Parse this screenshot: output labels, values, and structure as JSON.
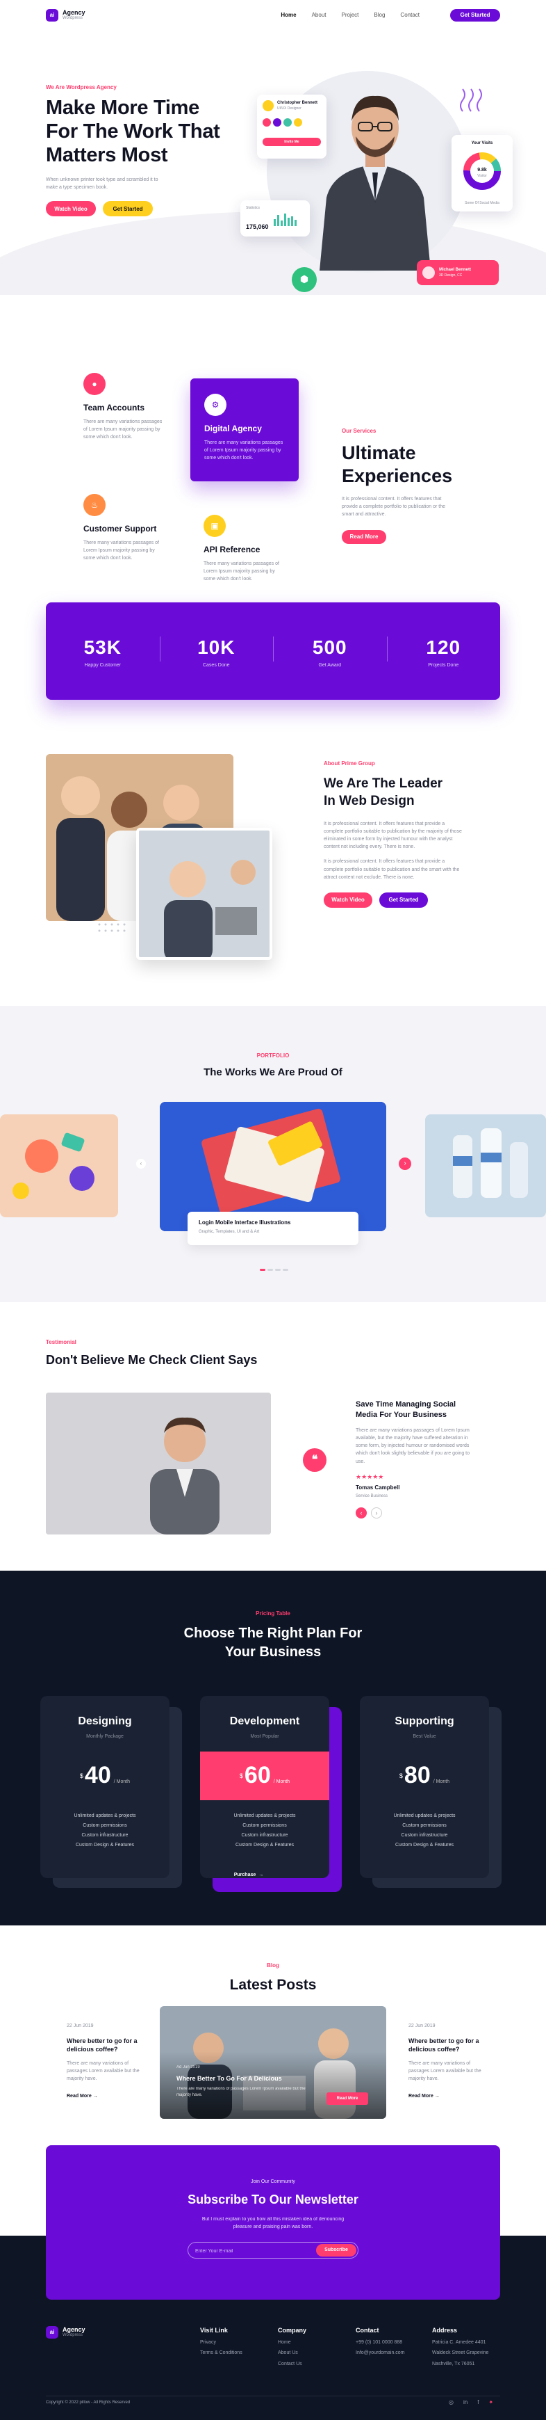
{
  "brand": {
    "name": "Agency",
    "tagline": "Wordpress",
    "mark": "ai"
  },
  "nav": {
    "links": [
      "Home",
      "About",
      "Project",
      "Blog",
      "Contact"
    ],
    "active": "Home",
    "cta": "Get Started"
  },
  "hero": {
    "eyebrow": "We Are Wordpress Agency",
    "title_lines": [
      "Make More Time",
      "For The Work That",
      "Matters Most"
    ],
    "desc": "When unknown printer took type and scrambled it to make a type specimen book.",
    "btn_watch": "Watch Video",
    "btn_start": "Get Started",
    "profile": {
      "name": "Christopher Bennett",
      "role": "UI/UX Designer",
      "button": "Invite Me"
    },
    "analytics": {
      "label": "Statistics",
      "value": "175,060"
    },
    "visits": {
      "title": "Your Visits",
      "center_top": "9.8k",
      "center_sub": "Visitor",
      "footer": "Some Of Social Media"
    },
    "badge": {
      "name": "Michael Bennett",
      "sub": "3D Design, CC"
    },
    "colors": {
      "accent": "#6a0bd8",
      "pink": "#ff3d6e",
      "yellow": "#ffcf1f"
    }
  },
  "services": {
    "items": [
      {
        "icon": "drop-icon",
        "title": "Team Accounts",
        "desc": "There are many variations passages of Lorem Ipsum majority passing by some which don't look."
      },
      {
        "icon": "gear-icon",
        "title": "Digital Agency",
        "desc": "There are many variations passages of Lorem Ipsum majority passing by some which don't look."
      },
      {
        "icon": "flame-icon",
        "title": "Customer Support",
        "desc": "There many variations passages of Lorem Ipsum majority passing by some which don't look."
      },
      {
        "icon": "wallet-icon",
        "title": "API Reference",
        "desc": "There many variations passages of Lorem Ipsum majority passing by some which don't look."
      }
    ],
    "eyebrow": "Our Services",
    "title_lines": [
      "Ultimate",
      "Experiences"
    ],
    "desc": "It is professional content. It offers features that provide a complete portfolio to publication or the smart and attractive.",
    "btn": "Read More"
  },
  "stats": [
    {
      "value": "53K",
      "label": "Happy Customer"
    },
    {
      "value": "10K",
      "label": "Cases Done"
    },
    {
      "value": "500",
      "label": "Get Award"
    },
    {
      "value": "120",
      "label": "Projects Done"
    }
  ],
  "about": {
    "eyebrow": "About Prime Group",
    "title_lines": [
      "We Are The Leader",
      "In Web Design"
    ],
    "p1": "It is professional content. It offers features that provide a complete portfolio suitable to publication by the majority of those eliminated in some form by injected humour with the analyst content not including every. There is none.",
    "p2": "It is professional content. It offers features that provide a complete portfolio suitable to publication and the smart with the attract content not exclude. There is none.",
    "btn_watch": "Watch Video",
    "btn_start": "Get Started"
  },
  "portfolio": {
    "eyebrow": "PORTFOLIO",
    "title": "The Works We Are Proud Of",
    "card_title": "Login Mobile Interface Illustrations",
    "card_sub": "Graphic, Templates, UI and & Art"
  },
  "testimonial": {
    "eyebrow": "Testimonial",
    "title": "Don't Believe Me Check Client Says",
    "quote_title_lines": [
      "Save Time Managing Social",
      "Media For Your Business"
    ],
    "quote": "There are many variations passages of Lorem Ipsum available, but the majority have suffered alteration in some form, by injected humour or randomised words which don't look slightly believable if you are going to use.",
    "stars": "★★★★★",
    "name": "Tomas Campbell",
    "role": "Service Business"
  },
  "pricing": {
    "eyebrow": "Pricing Table",
    "title_lines": [
      "Choose The Right Plan For",
      "Your Business"
    ],
    "plans": [
      {
        "name": "Designing",
        "sub": "Monthly Package",
        "currency": "$",
        "price": "40",
        "per": "/ Month",
        "features": [
          "Unlimited updates & projects",
          "Custom permissions",
          "Custom infrastructure",
          "Custom Design & Features"
        ]
      },
      {
        "name": "Development",
        "sub": "Most Popular",
        "currency": "$",
        "price": "60",
        "per": "/ Month",
        "features": [
          "Unlimited updates & projects",
          "Custom permissions",
          "Custom infrastructure",
          "Custom Design & Features"
        ]
      },
      {
        "name": "Supporting",
        "sub": "Best Value",
        "currency": "$",
        "price": "80",
        "per": "/ Month",
        "features": [
          "Unlimited updates & projects",
          "Custom permissions",
          "Custom infrastructure",
          "Custom Design & Features"
        ]
      }
    ],
    "cta": "Purchase"
  },
  "blog": {
    "eyebrow": "Blog",
    "title": "Latest Posts",
    "side_left": {
      "date": "22 Jun 2019",
      "title": "Where better to go for a delicious coffee?",
      "desc": "There are many variations of passages Lorem available but the majority have.",
      "more": "Read More"
    },
    "feature": {
      "date": "Ad Jun 2019",
      "title": "Where Better To Go For A Delicious",
      "desc": "There are many variations of passages Lorem Ipsum available but the majority have.",
      "btn": "Read More"
    },
    "side_right": {
      "date": "22 Jun 2019",
      "title": "Where better to go for a delicious coffee?",
      "desc": "There are many variations of passages Lorem available but the majority have.",
      "more": "Read More"
    }
  },
  "newsletter": {
    "eyebrow": "Join Our Community",
    "title": "Subscribe To Our Newsletter",
    "desc": "But I must explain to you how all this mistaken idea of denouncing pleasure and praising pain was born.",
    "placeholder": "Enter Your E-mail",
    "btn": "Subscribe"
  },
  "footer": {
    "cols": [
      {
        "title": "Visit Link",
        "items": [
          "Privacy",
          "Terms & Conditions"
        ]
      },
      {
        "title": "Company",
        "items": [
          "Home",
          "About Us",
          "Contact Us"
        ]
      },
      {
        "title": "Contact",
        "items": [
          "+99 (0) 101 0000 888",
          "Info@yourdomain.com"
        ]
      },
      {
        "title": "Address",
        "items": [
          "Patricia C. Amedee 4401",
          "Waldeck Street Grapevine",
          "Nashville, Tx 76051"
        ]
      }
    ],
    "copyright": "Copyright © 2022 pillow - All Rights Reserved",
    "social": [
      "instagram-icon",
      "linkedin-icon",
      "facebook-icon",
      "twitter-icon"
    ]
  }
}
